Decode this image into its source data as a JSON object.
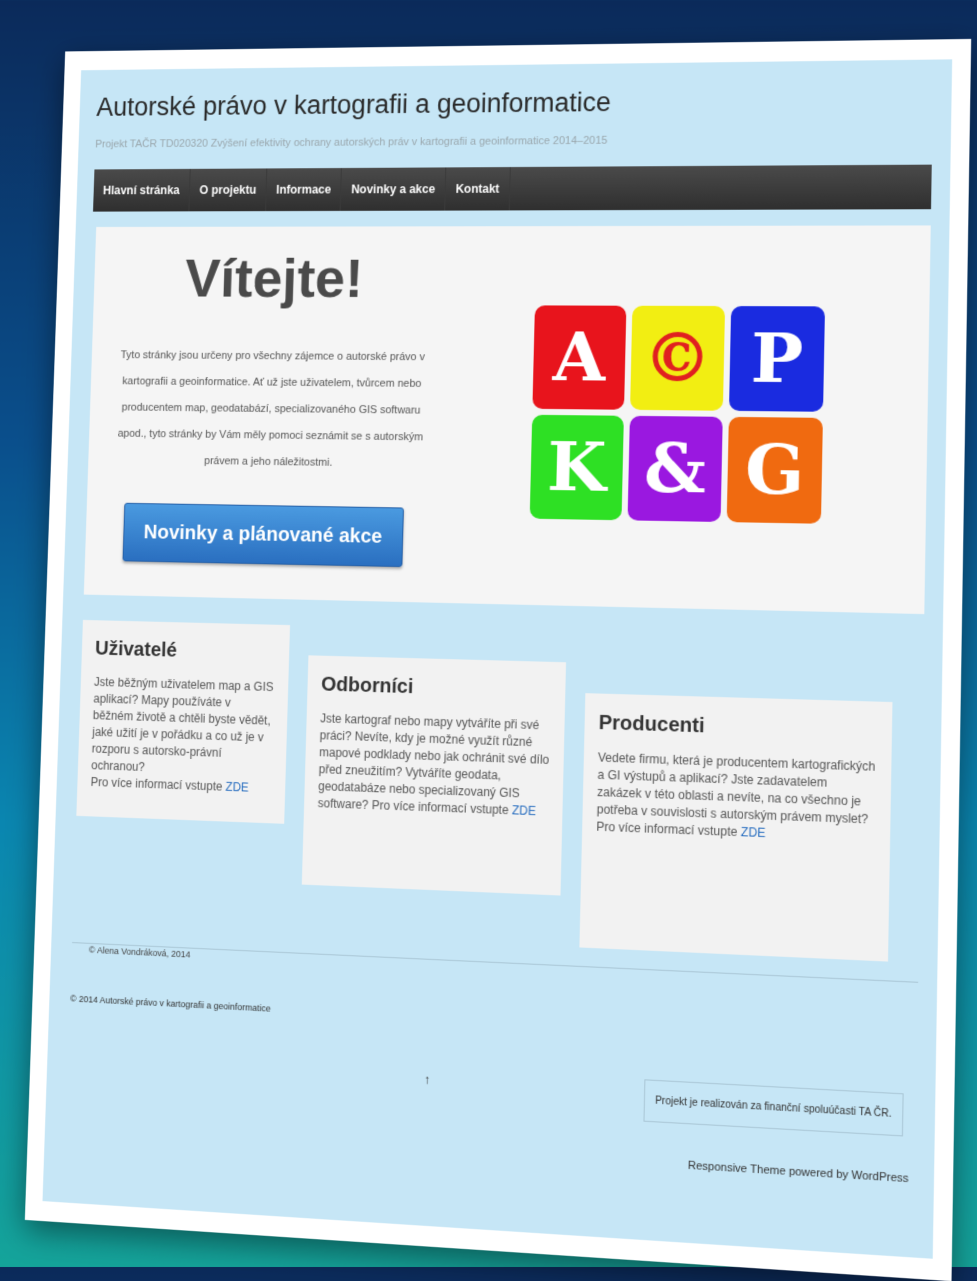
{
  "site": {
    "title": "Autorské právo v kartografii a geoinformatice",
    "description": "Projekt TAČR TD020320 Zvýšení efektivity ochrany autorských práv v kartografii a geoinformatice 2014–2015"
  },
  "nav": {
    "items": [
      "Hlavní stránka",
      "O projektu",
      "Informace",
      "Novinky a akce",
      "Kontakt"
    ]
  },
  "hero": {
    "heading": "Vítejte!",
    "text": "Tyto stránky jsou určeny pro všechny zájemce o autorské právo v kartografii a geoinformatice. Ať už jste uživatelem, tvůrcem nebo producentem map, geodatabází, specializovaného GIS softwaru apod., tyto stránky by Vám měly pomoci seznámit se s autorským právem a jeho náležitostmi.",
    "button": "Novinky a plánované akce"
  },
  "logo": {
    "tiles": [
      {
        "letter": "A",
        "color": "#e8141c"
      },
      {
        "letter": "©",
        "color": "#f2ee12"
      },
      {
        "letter": "P",
        "color": "#1a2be0"
      },
      {
        "letter": "K",
        "color": "#2ee024"
      },
      {
        "letter": "&",
        "color": "#9a18e0"
      },
      {
        "letter": "G",
        "color": "#f06a10"
      }
    ]
  },
  "cards": [
    {
      "title": "Uživatelé",
      "text": "Jste běžným uživatelem map a GIS aplikací? Mapy používáte v běžném životě a chtěli byste vědět, jaké užití je v pořádku a co už je v rozporu s autorsko-právní ochranou?",
      "more": "Pro více informací vstupte",
      "link": "ZDE"
    },
    {
      "title": "Odborníci",
      "text": "Jste kartograf nebo mapy vytváříte při své práci? Nevíte, kdy je možné využít různé mapové podklady nebo jak ochránit své dílo před zneužitím? Vytváříte geodata, geodatabáze nebo specializovaný GIS software?",
      "more": "Pro více informací vstupte",
      "link": "ZDE"
    },
    {
      "title": "Producenti",
      "text": "Vedete firmu, která je producentem kartografických a GI výstupů a aplikací? Jste zadavatelem zakázek v této oblasti a nevíte, na co všechno je potřeba v souvislosti s autorským právem myslet?",
      "more": "Pro více informací vstupte",
      "link": "ZDE"
    }
  ],
  "footer": {
    "author": "© Alena Vondráková, 2014",
    "copyright": "© 2014 Autorské právo v kartografii a geoinformatice",
    "arrow": "↑",
    "funding": "Projekt je realizován za finanční spoluúčasti TA ČR.",
    "powered": "Responsive Theme powered by WordPress"
  }
}
